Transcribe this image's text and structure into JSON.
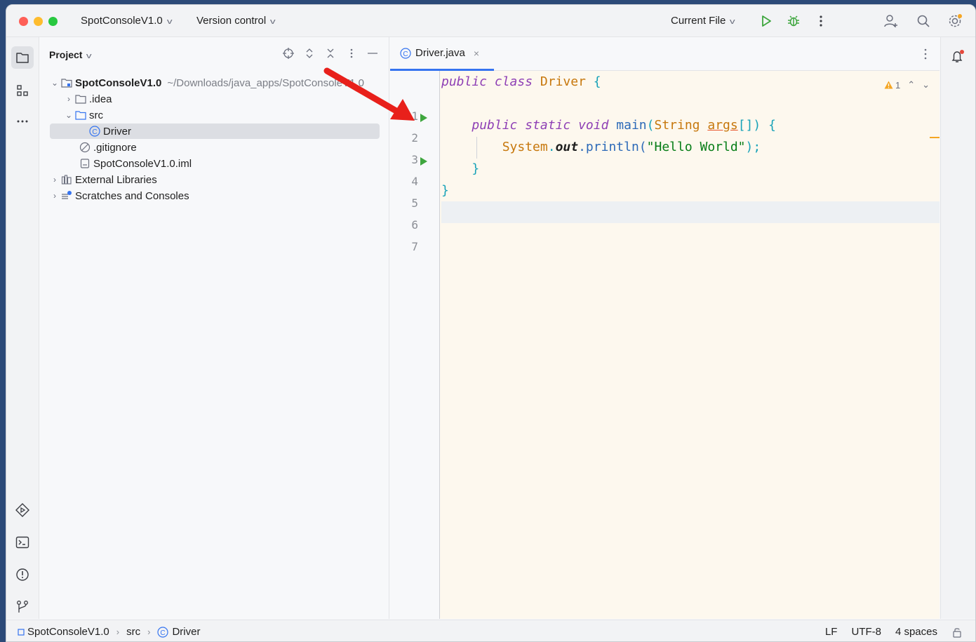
{
  "window": {
    "project_name": "SpotConsoleV1.0",
    "vcs_label": "Version control",
    "run_config": "Current File"
  },
  "project_panel": {
    "title": "Project",
    "tree": [
      {
        "label": "SpotConsoleV1.0",
        "path": "~/Downloads/java_apps/SpotConsoleV1.0"
      },
      {
        "label": ".idea"
      },
      {
        "label": "src"
      },
      {
        "label": "Driver"
      },
      {
        "label": ".gitignore"
      },
      {
        "label": "SpotConsoleV1.0.iml"
      },
      {
        "label": "External Libraries"
      },
      {
        "label": "Scratches and Consoles"
      }
    ]
  },
  "editor": {
    "tab_label": "Driver.java",
    "warning_count": "1",
    "line_numbers": [
      "1",
      "2",
      "3",
      "4",
      "5",
      "6",
      "7"
    ],
    "code": {
      "l1_kw": "public class",
      "l1_cls": "Driver",
      "l1_brace": "{",
      "l3_kw": "public static void",
      "l3_fn": "main",
      "l3_paren": "(",
      "l3_type": "String",
      "l3_arg": "args",
      "l3_rest": "[]) {",
      "l4_sys": "System",
      "l4_dot": ".",
      "l4_out": "out",
      "l4_call": ".println(",
      "l4_str": "\"Hello World\"",
      "l4_end": ");",
      "l5": "}",
      "l6": "}"
    }
  },
  "statusbar": {
    "breadcrumb": [
      "SpotConsoleV1.0",
      "src",
      "Driver"
    ],
    "line_sep": "LF",
    "encoding": "UTF-8",
    "indent": "4 spaces"
  },
  "colors": {
    "accent": "#3574f0",
    "run_green": "#3ea63e",
    "annotation_red": "#e8201b",
    "editor_bg": "#fdf8ee"
  }
}
